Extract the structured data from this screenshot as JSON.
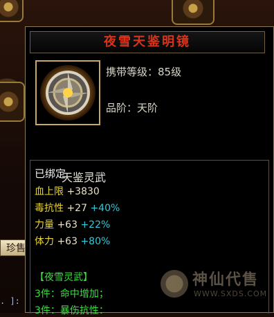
{
  "scene": {
    "tab_label": "珍售",
    "bottom_text": ". ]:"
  },
  "tooltip": {
    "title": "夜雪天鉴明镜",
    "carry_level_label": "携带等级：",
    "carry_level_value": "85级",
    "rank_label": "品阶：",
    "rank_value": "天阶",
    "subtitle": "天鉴灵武",
    "bound": "已绑定",
    "stats": [
      {
        "name": "血上限",
        "value": "+3830",
        "percent": ""
      },
      {
        "name": "毒抗性",
        "value": "+27",
        "percent": "+40%"
      },
      {
        "name": "力量",
        "value": "+63",
        "percent": "+22%"
      },
      {
        "name": "体力",
        "value": "+63",
        "percent": "+80%"
      }
    ],
    "set_name": "【夜雪灵武】",
    "set_bonuses": [
      "3件：命中增加；",
      "3件：暴伤抗性："
    ]
  },
  "watermark": {
    "name": "神仙代售",
    "url": "WWW.SXDS.COM"
  },
  "colors": {
    "title": "#d8341c",
    "stat_name": "#e8d43a",
    "percent": "#35c8d8",
    "set": "#36e03a"
  }
}
